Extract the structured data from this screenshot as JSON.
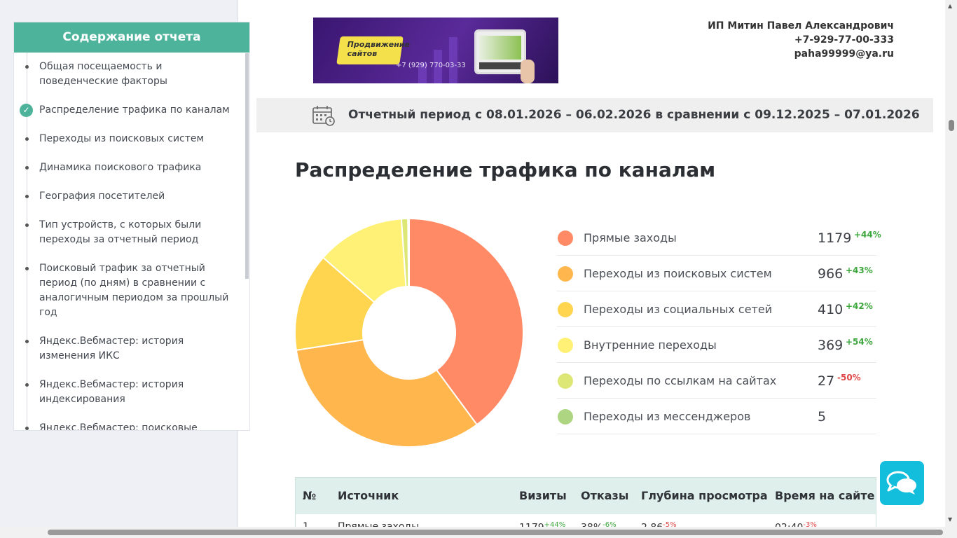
{
  "toc": {
    "title": "Содержание отчета",
    "items": [
      {
        "label": "Общая посещаемость и поведенческие факторы",
        "active": false
      },
      {
        "label": "Распределение трафика по каналам",
        "active": true
      },
      {
        "label": "Переходы из поисковых систем",
        "active": false
      },
      {
        "label": "Динамика поискового трафика",
        "active": false
      },
      {
        "label": "География посетителей",
        "active": false
      },
      {
        "label": "Тип устройств, с которых были переходы за отчетный период",
        "active": false
      },
      {
        "label": "Поисковый трафик за отчетный период (по дням) в сравнении с аналогичным периодом за прошлый год",
        "active": false
      },
      {
        "label": "Яндекс.Вебмастер: история изменения ИКС",
        "active": false
      },
      {
        "label": "Яндекс.Вебмастер: история индексирования",
        "active": false
      },
      {
        "label": "Яндекс.Вебмастер: поисковые запросы",
        "active": false
      }
    ]
  },
  "banner": {
    "tagline": "Продвижение сайтов",
    "phone": "+7 (929) 770-03-33"
  },
  "contact": {
    "name": "ИП Митин Павел Александрович",
    "phone": "+7-929-77-00-333",
    "email": "paha99999@ya.ru"
  },
  "period": {
    "text": "Отчетный период с 08.01.2026 – 06.02.2026 в сравнении с 09.12.2025 – 07.01.2026",
    "icon": "calendar-clock-icon"
  },
  "section_title": "Распределение трафика по каналам",
  "chart_data": {
    "type": "pie",
    "donut": true,
    "title": "Распределение трафика по каналам",
    "categories": [
      "Прямые заходы",
      "Переходы из поисковых систем",
      "Переходы из социальных сетей",
      "Внутренние переходы",
      "Переходы по ссылкам на сайтах",
      "Переходы из мессенджеров"
    ],
    "values": [
      1179,
      966,
      410,
      369,
      27,
      5
    ],
    "changes": [
      "+44%",
      "+43%",
      "+42%",
      "+54%",
      "-50%",
      ""
    ],
    "colors": [
      "#ff8a65",
      "#ffb74d",
      "#ffd54f",
      "#fff176",
      "#dce775",
      "#aed581"
    ],
    "legend_position": "right"
  },
  "table": {
    "headers": [
      "№",
      "Источник",
      "Визиты",
      "Отказы",
      "Глубина просмотра",
      "Время на сайте"
    ],
    "rows": [
      {
        "num": "1",
        "source": "Прямые заходы",
        "visits": "1179",
        "visits_chg": "+44%",
        "bounce": "38%",
        "bounce_chg": "-6%",
        "depth": "2.86",
        "depth_chg": "-5%",
        "time": "02:40",
        "time_chg": "-3%"
      }
    ]
  },
  "chat": {
    "icon": "chat-bubbles-icon"
  }
}
